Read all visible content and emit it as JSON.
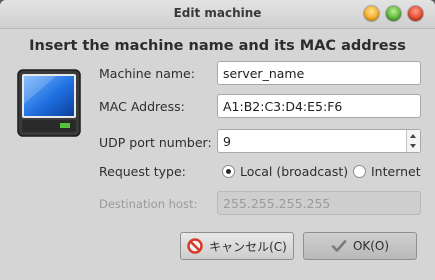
{
  "window": {
    "title": "Edit machine"
  },
  "heading": "Insert the machine name and its MAC address",
  "form": {
    "machine_name_label": "Machine name:",
    "machine_name_value": "server_name",
    "mac_label": "MAC Address:",
    "mac_value": "A1:B2:C3:D4:E5:F6",
    "udp_label": "UDP port number:",
    "udp_value": "9",
    "request_type_label": "Request type:",
    "request_options": [
      "Local (broadcast)",
      "Internet"
    ],
    "request_selected": "Local (broadcast)",
    "destination_label": "Destination host:",
    "destination_value": "255.255.255.255"
  },
  "buttons": {
    "cancel_label": "キャンセル(C)",
    "ok_label": "OK(O)"
  },
  "colors": {
    "window_bg": "#d5d5d5",
    "title_bg": "#dadada",
    "cancel_icon": "#d83a2a",
    "ok_icon": "#7a7a7a"
  },
  "icons": [
    "minimize-icon",
    "maximize-icon",
    "close-icon",
    "computer-monitor-icon",
    "cancel-icon",
    "checkmark-icon"
  ]
}
